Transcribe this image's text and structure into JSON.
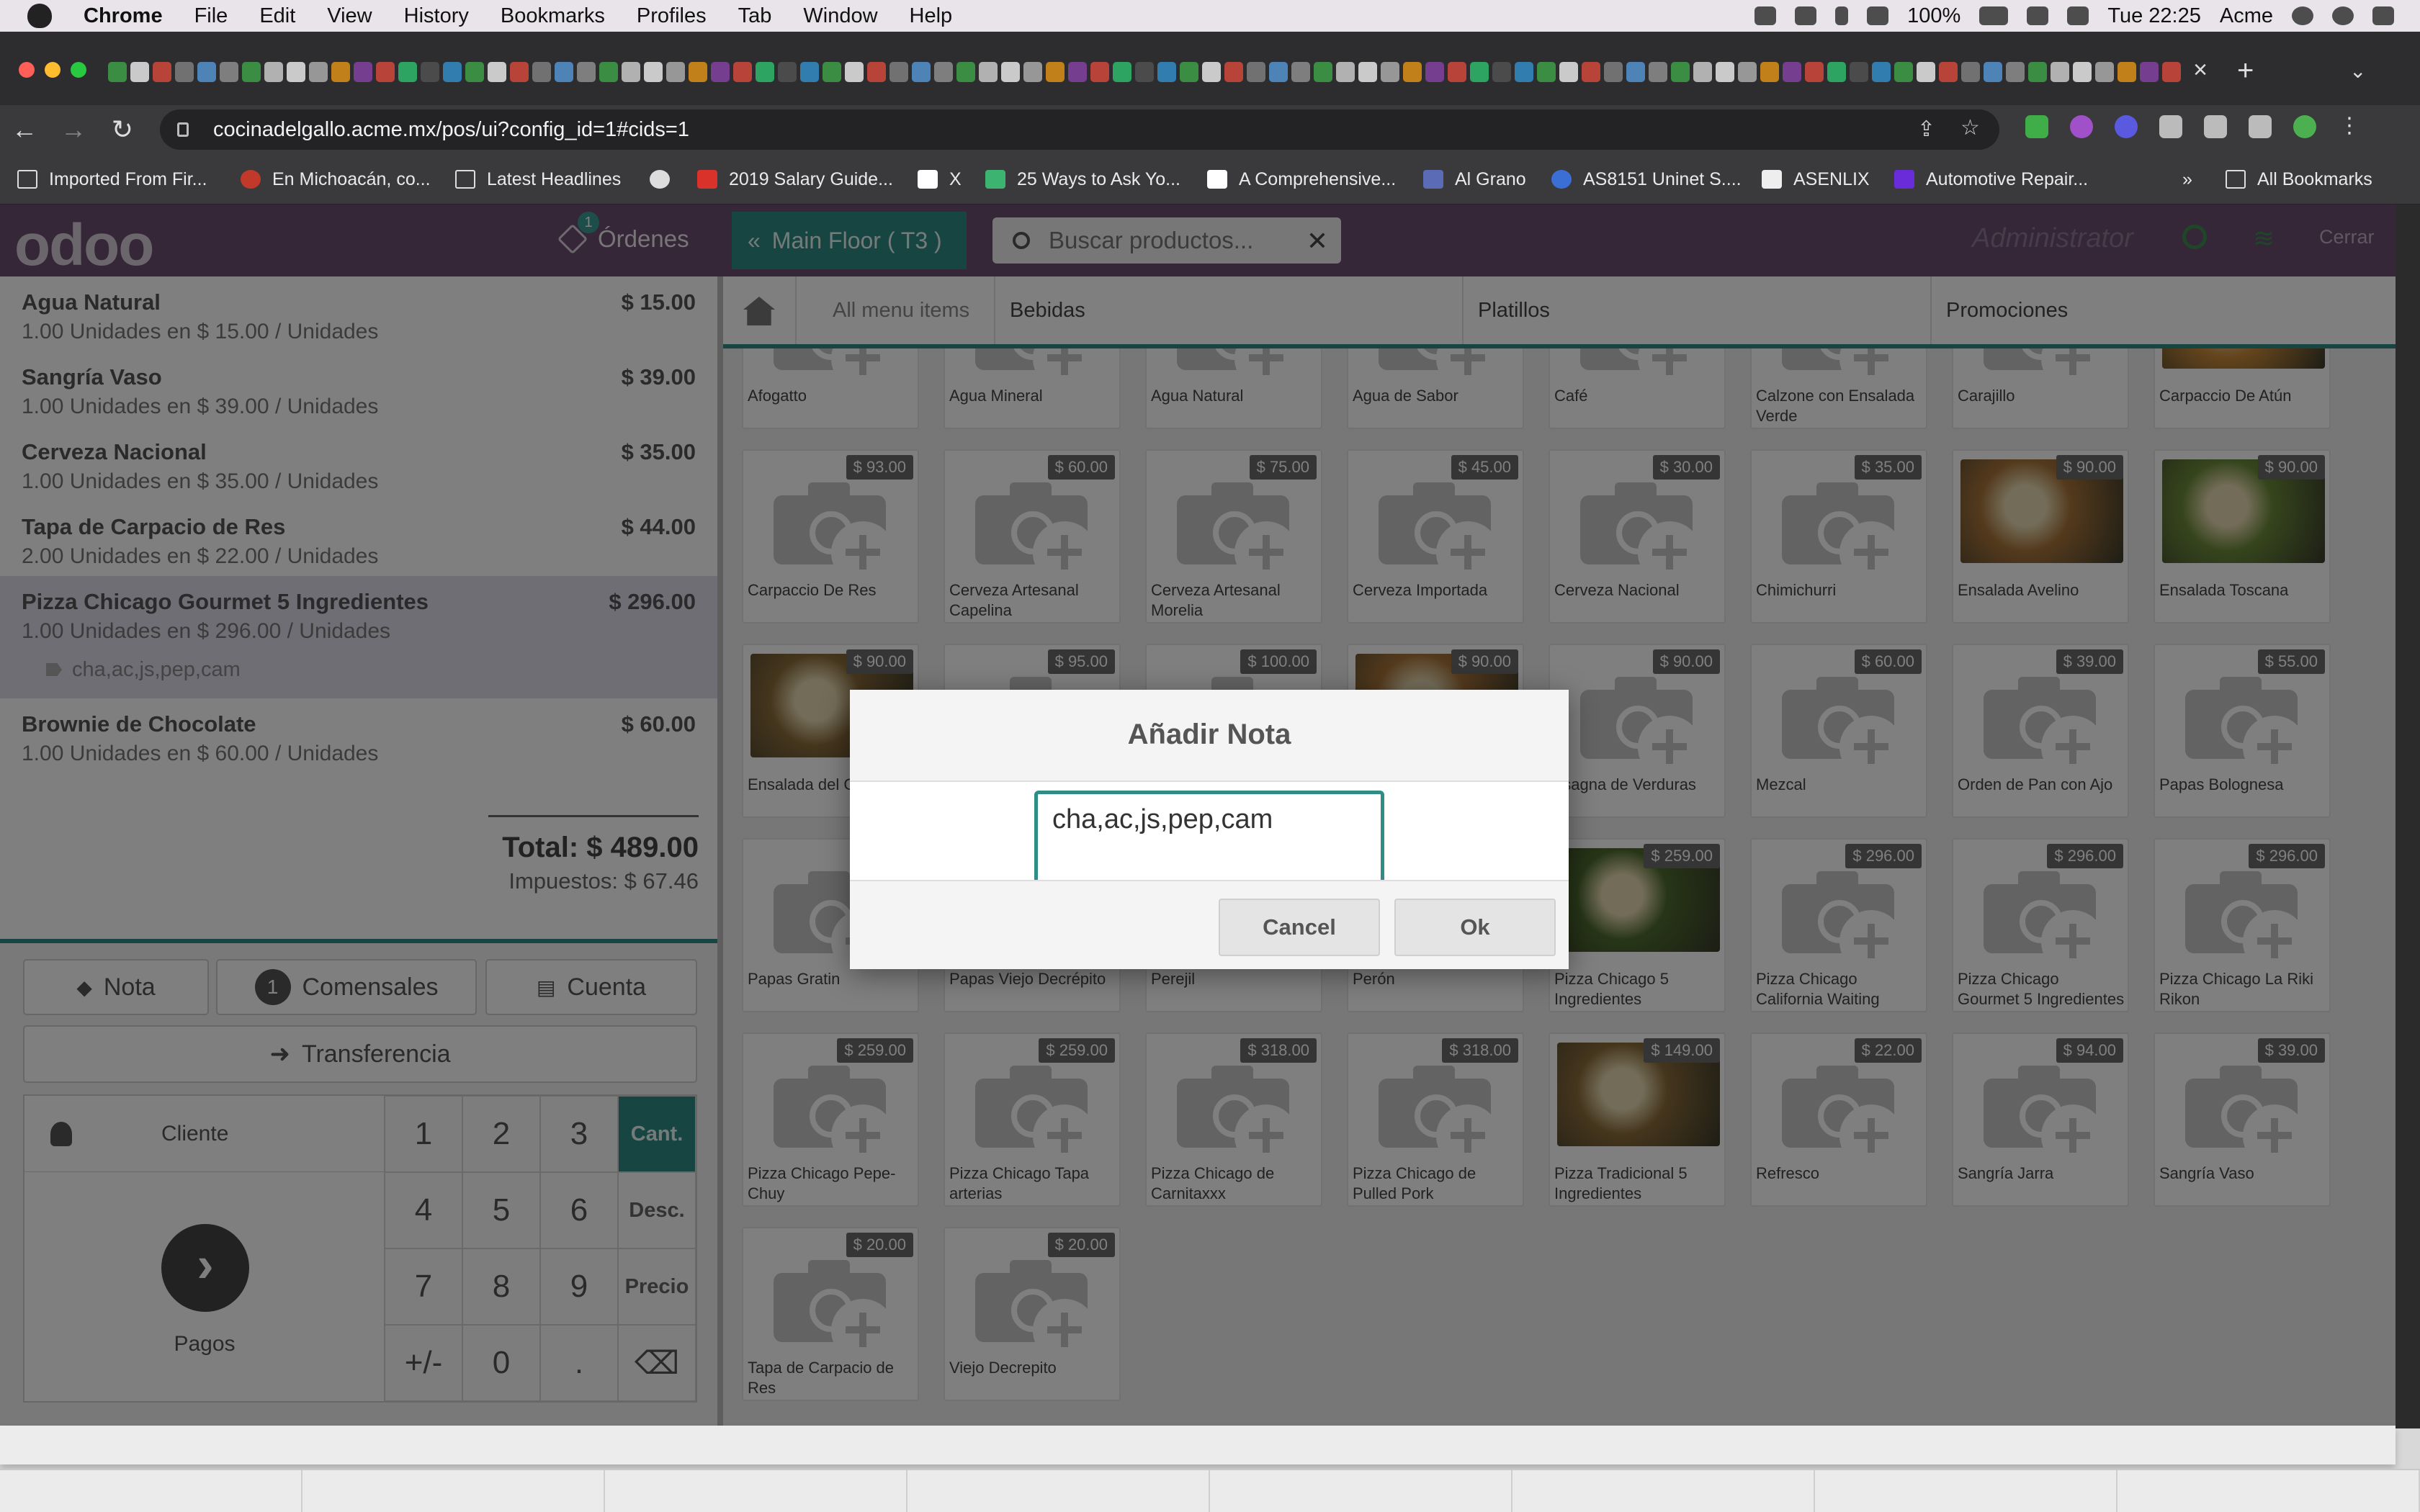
{
  "menubar": {
    "app": "Chrome",
    "items": [
      "File",
      "Edit",
      "View",
      "History",
      "Bookmarks",
      "Profiles",
      "Tab",
      "Window",
      "Help"
    ],
    "battery": "100%",
    "clock": "Tue 22:25",
    "user": "Acme"
  },
  "browser": {
    "url": "cocinadelgallo.acme.mx/pos/ui?config_id=1#cids=1",
    "bookmarks": [
      "Imported From Fir...",
      "En Michoacán, co...",
      "Latest Headlines",
      "2019 Salary Guide...",
      "X",
      "25 Ways to Ask Yo...",
      "A Comprehensive...",
      "Al Grano",
      "AS8151 Uninet S....",
      "ASENLIX",
      "Automotive Repair...",
      "All Bookmarks"
    ]
  },
  "pos": {
    "logo": "odoo",
    "orders_label": "Órdenes",
    "orders_count": "1",
    "floor_label": "Main Floor ( T3 )",
    "search_placeholder": "Buscar productos...",
    "user": "Administrator",
    "close_label": "Cerrar"
  },
  "order": {
    "lines": [
      {
        "name": "Agua Natural",
        "price": "$ 15.00",
        "info": "1.00 Unidades en $ 15.00 / Unidades",
        "note": ""
      },
      {
        "name": "Sangría Vaso",
        "price": "$ 39.00",
        "info": "1.00 Unidades en $ 39.00 / Unidades",
        "note": ""
      },
      {
        "name": "Cerveza Nacional",
        "price": "$ 35.00",
        "info": "1.00 Unidades en $ 35.00 / Unidades",
        "note": ""
      },
      {
        "name": "Tapa de Carpacio de Res",
        "price": "$ 44.00",
        "info": "2.00 Unidades en $ 22.00 / Unidades",
        "note": ""
      },
      {
        "name": "Pizza Chicago Gourmet 5 Ingredientes",
        "price": "$ 296.00",
        "info": "1.00 Unidades en $ 296.00 / Unidades",
        "note": "cha,ac,js,pep,cam"
      },
      {
        "name": "Brownie de Chocolate",
        "price": "$ 60.00",
        "info": "1.00 Unidades en $ 60.00 / Unidades",
        "note": ""
      }
    ],
    "total": "Total: $ 489.00",
    "taxes": "Impuestos: $ 67.46"
  },
  "actions": {
    "nota": "Nota",
    "comensales_count": "1",
    "comensales": "Comensales",
    "cuenta": "Cuenta",
    "transferencia": "Transferencia"
  },
  "numpad": {
    "cliente": "Cliente",
    "pagos": "Pagos",
    "keys": [
      "1",
      "2",
      "3",
      "Cant.",
      "4",
      "5",
      "6",
      "Desc.",
      "7",
      "8",
      "9",
      "Precio",
      "+/-",
      "0",
      "."
    ],
    "active_mode": "Cant."
  },
  "categories": {
    "breadcrumb": "All menu items",
    "items": [
      "Bebidas",
      "Platillos",
      "Promociones"
    ]
  },
  "products": [
    {
      "name": "Afogatto",
      "price": "",
      "image": false
    },
    {
      "name": "Agua Mineral",
      "price": "",
      "image": false
    },
    {
      "name": "Agua Natural",
      "price": "",
      "image": false
    },
    {
      "name": "Agua de Sabor",
      "price": "",
      "image": false
    },
    {
      "name": "Café",
      "price": "",
      "image": false
    },
    {
      "name": "Calzone con Ensalada Verde",
      "price": "",
      "image": false
    },
    {
      "name": "Carajillo",
      "price": "",
      "image": false
    },
    {
      "name": "Carpaccio De Atún",
      "price": "",
      "image": true
    },
    {
      "name": "Carpaccio De Res",
      "price": "$ 93.00",
      "image": false
    },
    {
      "name": "Cerveza Artesanal Capelina",
      "price": "$ 60.00",
      "image": false
    },
    {
      "name": "Cerveza Artesanal Morelia",
      "price": "$ 75.00",
      "image": false
    },
    {
      "name": "Cerveza Importada",
      "price": "$ 45.00",
      "image": false
    },
    {
      "name": "Cerveza Nacional",
      "price": "$ 30.00",
      "image": false
    },
    {
      "name": "Chimichurri",
      "price": "$ 35.00",
      "image": false
    },
    {
      "name": "Ensalada Avelino",
      "price": "$ 90.00",
      "image": true
    },
    {
      "name": "Ensalada Toscana",
      "price": "$ 90.00",
      "image": true
    },
    {
      "name": "Ensalada del C",
      "price": "$ 90.00",
      "image": true
    },
    {
      "name": "",
      "price": "$ 95.00",
      "image": false
    },
    {
      "name": "",
      "price": "$ 100.00",
      "image": false
    },
    {
      "name": "",
      "price": "$ 90.00",
      "image": true
    },
    {
      "name": "asagna de Verduras",
      "price": "$ 90.00",
      "image": false
    },
    {
      "name": "Mezcal",
      "price": "$ 60.00",
      "image": false
    },
    {
      "name": "Orden de Pan con Ajo",
      "price": "$ 39.00",
      "image": false
    },
    {
      "name": "Papas Bolognesa",
      "price": "$ 55.00",
      "image": false
    },
    {
      "name": "Papas Gratin",
      "price": "",
      "image": false
    },
    {
      "name": "Papas Viejo Decrépito",
      "price": "",
      "image": false
    },
    {
      "name": "Perejil",
      "price": "",
      "image": false
    },
    {
      "name": "Perón",
      "price": "",
      "image": false
    },
    {
      "name": "Pizza Chicago 5 Ingredientes",
      "price": "$ 259.00",
      "image": true
    },
    {
      "name": "Pizza Chicago California Waiting",
      "price": "$ 296.00",
      "image": false
    },
    {
      "name": "Pizza Chicago Gourmet 5 Ingredientes",
      "price": "$ 296.00",
      "image": false
    },
    {
      "name": "Pizza Chicago La Riki Rikon",
      "price": "$ 296.00",
      "image": false
    },
    {
      "name": "Pizza Chicago Pepe-Chuy",
      "price": "$ 259.00",
      "image": false
    },
    {
      "name": "Pizza Chicago Tapa arterias",
      "price": "$ 259.00",
      "image": false
    },
    {
      "name": "Pizza Chicago de Carnitaxxx",
      "price": "$ 318.00",
      "image": false
    },
    {
      "name": "Pizza Chicago de Pulled Pork",
      "price": "$ 318.00",
      "image": false
    },
    {
      "name": "Pizza Tradicional 5 Ingredientes",
      "price": "$ 149.00",
      "image": true
    },
    {
      "name": "Refresco",
      "price": "$ 22.00",
      "image": false
    },
    {
      "name": "Sangría Jarra",
      "price": "$ 94.00",
      "image": false
    },
    {
      "name": "Sangría Vaso",
      "price": "$ 39.00",
      "image": false
    },
    {
      "name": "Tapa de Carpacio de Res",
      "price": "$ 20.00",
      "image": false
    },
    {
      "name": "Viejo Decrepito",
      "price": "$ 20.00",
      "image": false
    }
  ],
  "dialog": {
    "title": "Añadir Nota",
    "value": "cha,ac,js,pep,cam",
    "cancel": "Cancel",
    "ok": "Ok"
  },
  "colors": {
    "odoo_purple": "#6a4d70",
    "teal": "#2f8d85",
    "browser_dark": "#2d2d30"
  }
}
